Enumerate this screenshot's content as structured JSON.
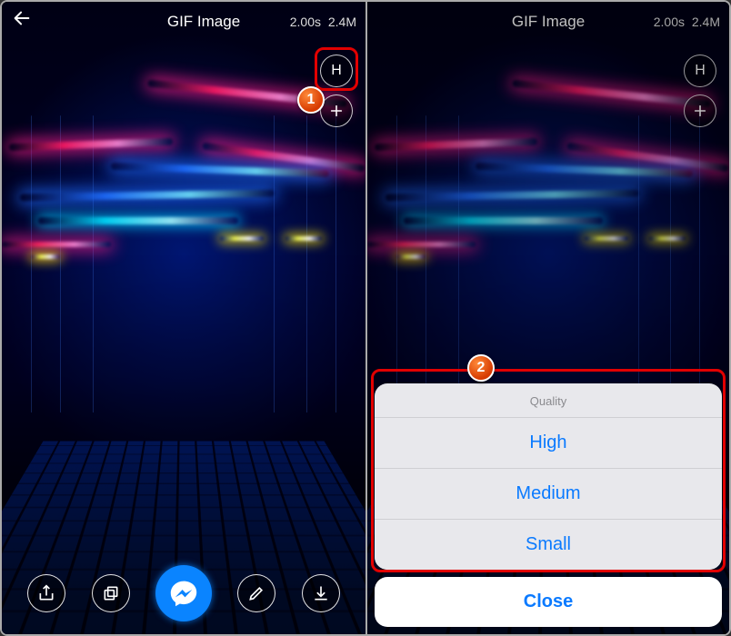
{
  "header": {
    "title": "GIF Image",
    "duration": "2.00s",
    "filesize": "2.4M"
  },
  "side": {
    "quality_letter": "H"
  },
  "quality_sheet": {
    "title": "Quality",
    "options": [
      "High",
      "Medium",
      "Small"
    ],
    "close": "Close"
  },
  "callouts": {
    "badge1": "1",
    "badge2": "2"
  }
}
